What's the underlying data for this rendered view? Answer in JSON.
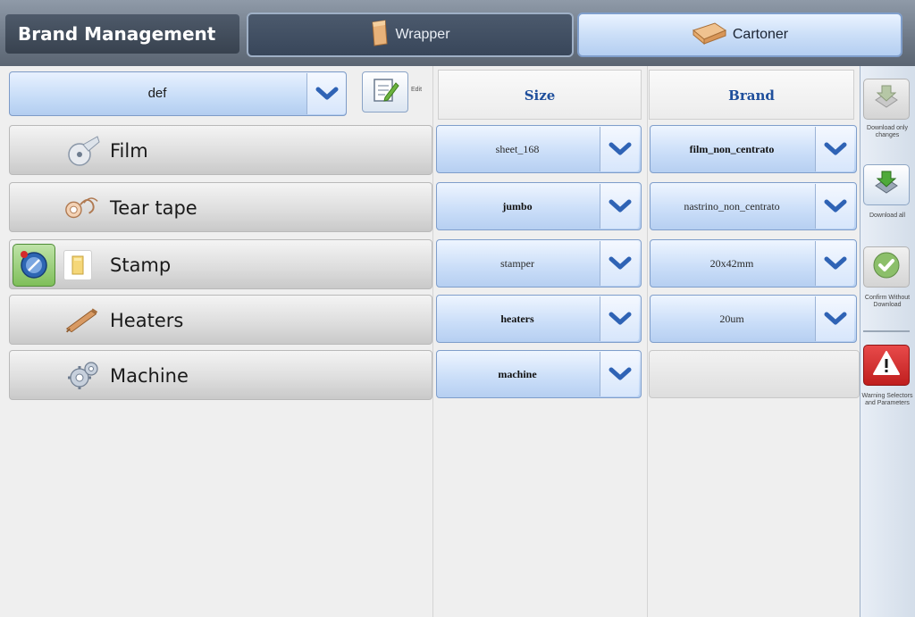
{
  "header": {
    "title": "Brand Management",
    "tabs": [
      {
        "label": "Wrapper",
        "icon": "wrapper-icon",
        "active": true
      },
      {
        "label": "Cartoner",
        "icon": "cartoner-icon",
        "active": false
      }
    ]
  },
  "profile": {
    "selected": "def",
    "edit_label": "Edit"
  },
  "columns": {
    "size": "Size",
    "brand": "Brand"
  },
  "rows": [
    {
      "label": "Film",
      "icon": "film-reel-icon",
      "size": "sheet_168",
      "brand": "film_non_centrato"
    },
    {
      "label": "Tear tape",
      "icon": "tear-tape-icon",
      "size": "jumbo",
      "brand": "nastrino_non_centrato"
    },
    {
      "label": "Stamp",
      "icon": "stamp-icon",
      "size": "stamper",
      "brand": "20x42mm"
    },
    {
      "label": "Heaters",
      "icon": "heater-icon",
      "size": "heaters",
      "brand": "20um"
    },
    {
      "label": "Machine",
      "icon": "gear-icon",
      "size": "machine",
      "brand": ""
    }
  ],
  "sidebar": {
    "download_changes": "Download only changes",
    "download_all": "Download all",
    "confirm": "Confirm Without Download",
    "warning": "Warning Selectors and Parameters"
  },
  "colors": {
    "accent_blue": "#c9ddf7",
    "header_dark": "#38424f",
    "warning_red": "#d52b2b",
    "confirm_green": "#8cbf6a"
  }
}
